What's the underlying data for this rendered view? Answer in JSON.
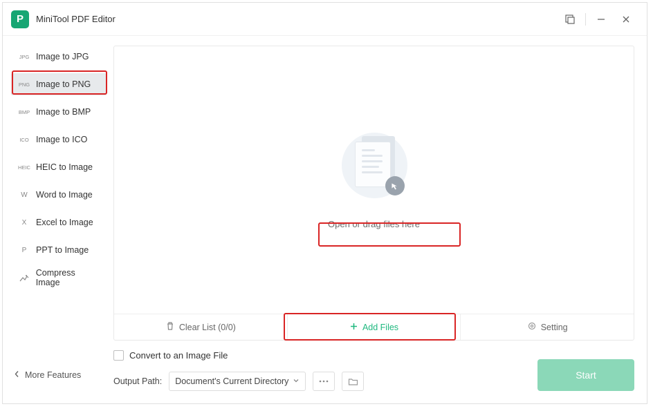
{
  "title": "MiniTool PDF Editor",
  "sidebar": {
    "items": [
      {
        "badge": "JPG",
        "label": "Image to JPG"
      },
      {
        "badge": "PNG",
        "label": "Image to PNG"
      },
      {
        "badge": "BMP",
        "label": "Image to BMP"
      },
      {
        "badge": "ICO",
        "label": "Image to ICO"
      },
      {
        "badge": "HEIC",
        "label": "HEIC to Image"
      },
      {
        "badge": "W",
        "label": "Word to Image"
      },
      {
        "badge": "X",
        "label": "Excel to Image"
      },
      {
        "badge": "P",
        "label": "PPT to Image"
      },
      {
        "badge": "",
        "label": "Compress Image"
      }
    ],
    "selected_index": 1
  },
  "dropzone": {
    "label": "Open or drag files here"
  },
  "actions": {
    "clear": "Clear List (0/0)",
    "add": "Add Files",
    "setting": "Setting"
  },
  "bottom": {
    "convert_check": "Convert to an Image File",
    "output_label": "Output Path:",
    "output_value": "Document's Current Directory",
    "start": "Start"
  },
  "more": "More Features"
}
